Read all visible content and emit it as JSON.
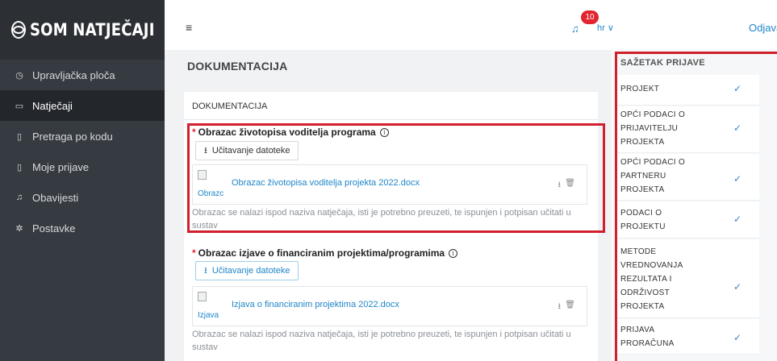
{
  "brand": {
    "name": "SOM NATJEČAJI"
  },
  "sidebar": {
    "items": [
      {
        "label": "Upravljačka ploča",
        "icon": "dashboard-icon",
        "glyph": "◷"
      },
      {
        "label": "Natječaji",
        "icon": "folder-icon",
        "glyph": "▭"
      },
      {
        "label": "Pretraga po kodu",
        "icon": "file-search-icon",
        "glyph": "▯"
      },
      {
        "label": "Moje prijave",
        "icon": "file-icon",
        "glyph": "▯"
      },
      {
        "label": "Obavijesti",
        "icon": "bell-icon",
        "glyph": "♫"
      },
      {
        "label": "Postavke",
        "icon": "gear-icon",
        "glyph": "✲"
      }
    ],
    "active_index": 1
  },
  "header": {
    "menu_icon": "≡",
    "notifications_count": "10",
    "bell_glyph": "♫",
    "language": "hr ∨",
    "logout": "Odjava"
  },
  "main": {
    "title": "DOKUMENTACIJA",
    "section_title": "DOKUMENTACIJA",
    "fields": [
      {
        "required_mark": "*",
        "label": "Obrazac životopisa voditelja programa",
        "upload_label": "Učitavanje datoteke",
        "file_name": "Obrazac životopisa voditelja projekta 2022.docx",
        "file_alt": "Obrazc",
        "help": "Obrazac se nalazi ispod naziva natječaja, isti je potrebno preuzeti, te ispunjen i potpisan učitati u sustav"
      },
      {
        "required_mark": "*",
        "label": "Obrazac izjave o financiranim projektima/programima",
        "upload_label": "Učitavanje datoteke",
        "file_name": "Izjava o financiranim projektima 2022.docx",
        "file_alt": "Izjava",
        "help": "Obrazac se nalazi ispod naziva natječaja, isti je potrebno preuzeti, te ispunjen i potpisan učitati u sustav"
      }
    ]
  },
  "summary": {
    "title": "SAŽETAK PRIJAVE",
    "check": "✓",
    "items": [
      {
        "label": "PROJEKT",
        "done": true
      },
      {
        "label": "OPĆI PODACI O\nPRIJAVITELJU\nPROJEKTA",
        "done": true
      },
      {
        "label": "OPĆI PODACI O\nPARTNERU\nPROJEKTA",
        "done": true
      },
      {
        "label": "PODACI O\nPROJEKTU",
        "done": true
      },
      {
        "label": "METODE\nVREDNOVANJA\nREZULTATA I\nODRŽIVOST\nPROJEKTA",
        "done": true
      },
      {
        "label": "PRIJAVA\nPRORAČUNA",
        "done": true
      }
    ]
  },
  "colors": {
    "sidebar_bg": "#363b41",
    "active_item_bg": "#23272b",
    "link_blue": "#1f86c8",
    "highlight_red": "#d11f2e",
    "badge_red": "#e2242f"
  }
}
